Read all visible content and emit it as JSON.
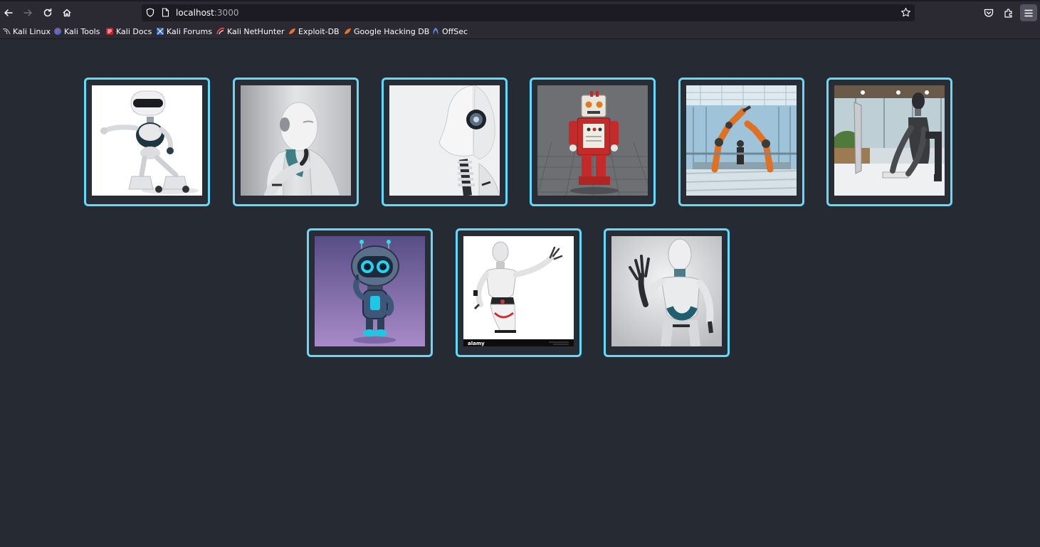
{
  "browser": {
    "url_host": "localhost",
    "url_port": ":3000",
    "bookmarks": [
      {
        "label": "Kali Linux",
        "icon": "kali-dragon-icon"
      },
      {
        "label": "Kali Tools",
        "icon": "kali-tools-icon"
      },
      {
        "label": "Kali Docs",
        "icon": "kali-docs-icon"
      },
      {
        "label": "Kali Forums",
        "icon": "kali-forums-icon"
      },
      {
        "label": "Kali NetHunter",
        "icon": "nethunter-icon"
      },
      {
        "label": "Exploit-DB",
        "icon": "exploit-db-icon"
      },
      {
        "label": "Google Hacking DB",
        "icon": "ghdb-icon"
      },
      {
        "label": "OffSec",
        "icon": "offsec-icon"
      }
    ]
  },
  "colors": {
    "page_background": "#262a33",
    "tile_border": "#61dafb",
    "tile_background": "#282c34"
  },
  "gallery": {
    "images": [
      {
        "subject": "white cartoon robot with visor presenting"
      },
      {
        "subject": "humanoid robot thinking with hand on chin"
      },
      {
        "subject": "humanoid robot head in profile"
      },
      {
        "subject": "red and white retro toy robot on grid"
      },
      {
        "subject": "orange industrial robot arms in factory"
      },
      {
        "subject": "humanoid robot working at computer desk"
      },
      {
        "subject": "cute blue robot on purple background"
      },
      {
        "subject": "white female android gesturing",
        "caption": "alamy"
      },
      {
        "subject": "white humanoid robot waving"
      }
    ]
  }
}
